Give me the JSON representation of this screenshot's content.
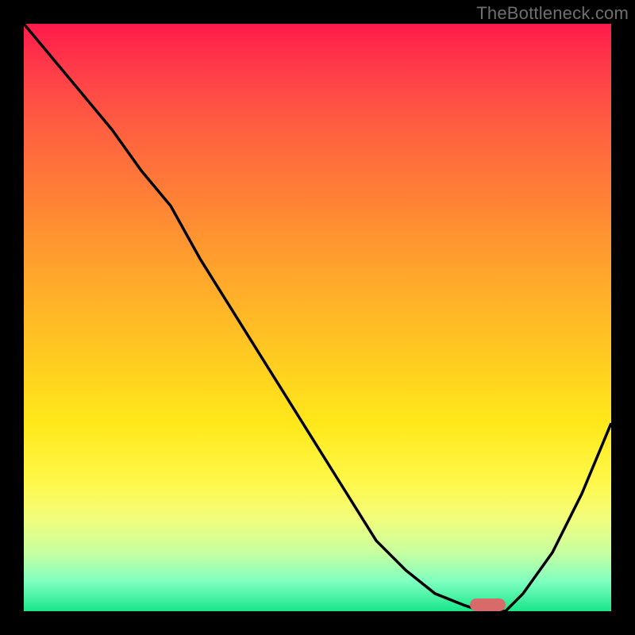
{
  "watermark": "TheBottleneck.com",
  "colors": {
    "marker": "#d86a6a",
    "curve": "#000000",
    "frame": "#000000"
  },
  "chart_data": {
    "type": "line",
    "title": "",
    "xlabel": "",
    "ylabel": "",
    "xlim": [
      0,
      100
    ],
    "ylim": [
      0,
      100
    ],
    "series": [
      {
        "name": "bottleneck-curve",
        "x": [
          0,
          5,
          10,
          15,
          20,
          25,
          30,
          35,
          40,
          45,
          50,
          55,
          60,
          65,
          70,
          75,
          78,
          80,
          82,
          85,
          90,
          95,
          100
        ],
        "y": [
          100,
          94,
          88,
          82,
          75,
          69,
          60,
          52,
          44,
          36,
          28,
          20,
          12,
          7,
          3,
          1,
          0,
          0,
          0,
          3,
          10,
          20,
          32
        ]
      }
    ],
    "marker": {
      "x_start": 76,
      "x_end": 82,
      "y": 0
    }
  }
}
